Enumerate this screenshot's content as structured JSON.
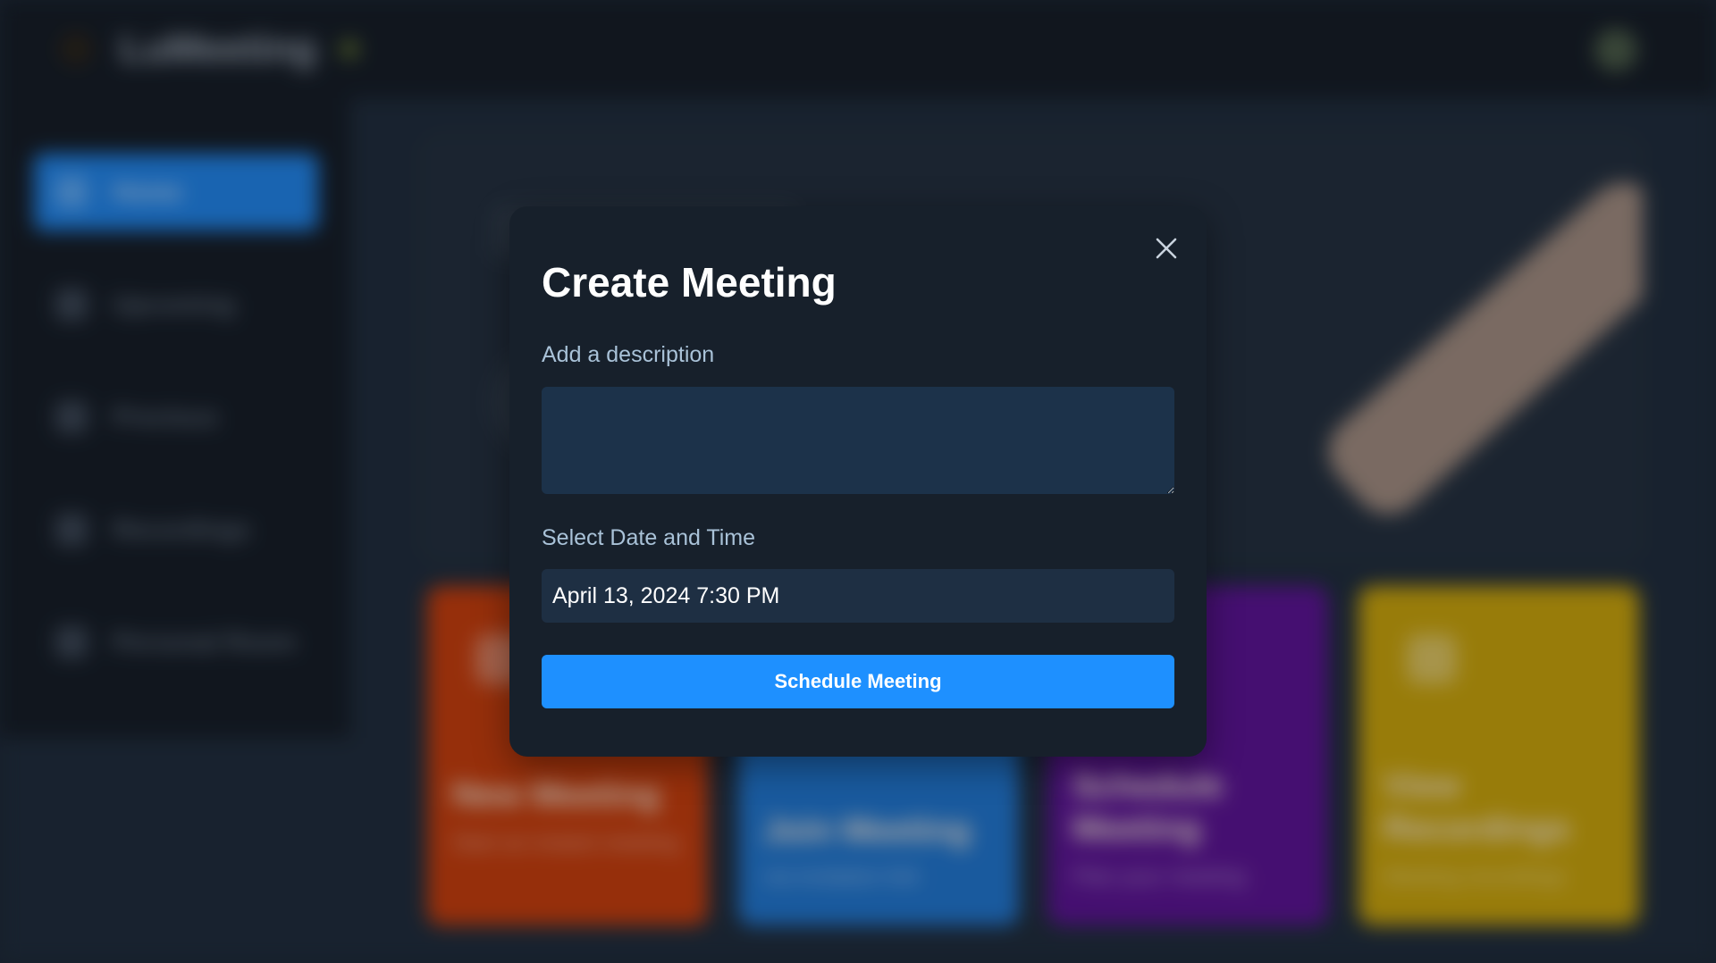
{
  "app": {
    "brand": "LuMeeting"
  },
  "sidebar": {
    "items": [
      {
        "label": "Home",
        "icon": "home-icon",
        "active": true
      },
      {
        "label": "Upcoming",
        "icon": "calendar-icon",
        "active": false
      },
      {
        "label": "Previous",
        "icon": "history-icon",
        "active": false
      },
      {
        "label": "Recordings",
        "icon": "video-icon",
        "active": false
      },
      {
        "label": "Personal Room",
        "icon": "plus-icon",
        "active": false
      }
    ]
  },
  "cards": [
    {
      "title": "New Meeting",
      "subtitle": "Start an instant meeting",
      "color": "#c63b08"
    },
    {
      "title": "Join Meeting",
      "subtitle": "via invitation link",
      "color": "#1f74cc"
    },
    {
      "title": "Schedule Meeting",
      "subtitle": "Plan your meeting",
      "color": "#5a1190"
    },
    {
      "title": "View Recordings",
      "subtitle": "Meeting recordings",
      "color": "#c9a207"
    }
  ],
  "modal": {
    "title": "Create Meeting",
    "description_label": "Add a description",
    "description_value": "",
    "date_label": "Select Date and Time",
    "date_value": "April 13, 2024 7:30 PM",
    "submit_label": "Schedule Meeting",
    "close_icon": "close-icon",
    "accent_color": "#1e90ff"
  }
}
